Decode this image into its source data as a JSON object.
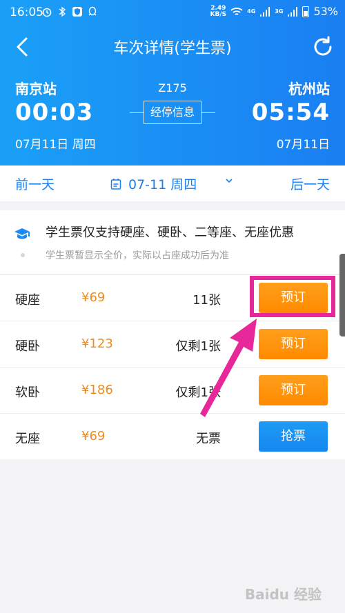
{
  "status_bar": {
    "time": "16:05",
    "net_speed": "2.49",
    "net_speed_unit": "KB/S",
    "signal_1": "4G",
    "signal_2": "3G",
    "battery": "53%"
  },
  "header": {
    "title": "车次详情(学生票)",
    "back_icon": "chevron-left-icon",
    "refresh_icon": "refresh-icon",
    "from_station": "南京站",
    "to_station": "杭州站",
    "train_no": "Z175",
    "departure_time": "00:03",
    "arrival_time": "05:54",
    "departure_date": "07月11日 周四",
    "arrival_date": "07月11日",
    "stops_label": "经停信息"
  },
  "date_bar": {
    "prev_label": "前一天",
    "next_label": "后一天",
    "current_date": "07-11 周四"
  },
  "notice": {
    "main": "学生票仅支持硬座、硬卧、二等座、无座优惠",
    "sub": "学生票暂显示全价，实际以占座成功后为准"
  },
  "seats": [
    {
      "name": "硬座",
      "price": "¥69",
      "remain": "11张",
      "action": "预订",
      "style": "orange"
    },
    {
      "name": "硬卧",
      "price": "¥123",
      "remain": "仅剩1张",
      "action": "预订",
      "style": "orange"
    },
    {
      "name": "软卧",
      "price": "¥186",
      "remain": "仅剩1张",
      "action": "预订",
      "style": "orange"
    },
    {
      "name": "无座",
      "price": "¥69",
      "remain": "无票",
      "action": "抢票",
      "style": "blue"
    }
  ],
  "colors": {
    "header_blue": "#1a8af4",
    "accent_orange": "#ff8a00",
    "price_orange": "#f08a1c",
    "highlight_pink": "#e7289b"
  },
  "watermark": "Baidu 经验"
}
